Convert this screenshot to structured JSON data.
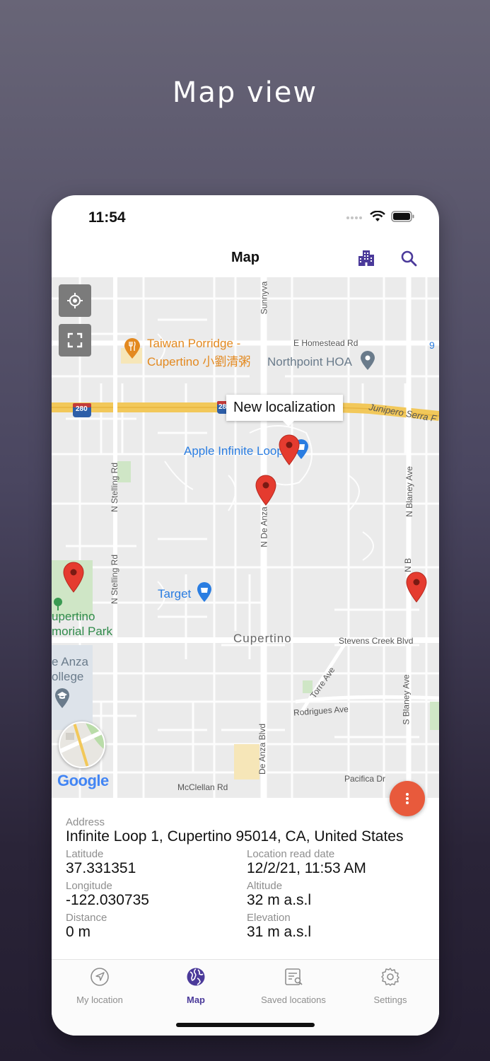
{
  "promo": {
    "title": "Map view"
  },
  "status_bar": {
    "time": "11:54"
  },
  "nav": {
    "title": "Map",
    "buildings_icon": "buildings-icon",
    "search_icon": "search-icon"
  },
  "map": {
    "controls": [
      "my-location-icon",
      "fullscreen-icon"
    ],
    "pois": {
      "taiwan_porridge_1": "Taiwan Porridge -",
      "taiwan_porridge_2": "Cupertino 小劉清粥",
      "northpoint": "Northpoint HOA",
      "apple": "Apple Infinite Loop",
      "target": "Target",
      "cupertino": "Cupertino",
      "memorial_1": "upertino",
      "memorial_2": "morial Park",
      "college_1": "e Anza",
      "college_2": "ollege"
    },
    "roads": {
      "homestead": "E Homestead Rd",
      "junipero": "Junipero Serra F",
      "sunnyvale": "Sunnyva",
      "stelling_1": "N Stelling Rd",
      "stelling_2": "N Stelling Rd",
      "deanza_n": "N De Anza",
      "deanza_blvd": "De Anza Blvd",
      "blaney_1": "N Blaney Ave",
      "blaney_2": "N B",
      "blaney_s": "S Blaney Ave",
      "stevens": "Stevens Creek Blvd",
      "torre": "Torre Ave",
      "rodrigues": "Rodrigues Ave",
      "pacifica": "Pacifica Dr",
      "mcclellan": "McClellan Rd",
      "i280": "280",
      "i280b": "28",
      "hwy9": "9"
    },
    "tooltip": "New localization",
    "google": "Google"
  },
  "colors": {
    "accent": "#4b3a9a",
    "pin": "#e53b2f",
    "fab": "#e85a3c",
    "poi_orange": "#e3891f",
    "poi_blue": "#2a7de1",
    "poi_gray": "#6a7b8b"
  },
  "info": {
    "address_label": "Address",
    "address": "Infinite Loop 1, Cupertino 95014, CA, United States",
    "latitude_label": "Latitude",
    "latitude": "37.331351",
    "read_date_label": "Location read date",
    "read_date": "12/2/21, 11:53 AM",
    "longitude_label": "Longitude",
    "longitude": "-122.030735",
    "altitude_label": "Altitude",
    "altitude": "32 m a.s.l",
    "distance_label": "Distance",
    "distance": "0 m",
    "elevation_label": "Elevation",
    "elevation": "31 m a.s.l"
  },
  "tabs": [
    {
      "label": "My location",
      "icon": "navigation-arrow-icon"
    },
    {
      "label": "Map",
      "icon": "globe-icon"
    },
    {
      "label": "Saved locations",
      "icon": "saved-list-icon"
    },
    {
      "label": "Settings",
      "icon": "gear-icon"
    }
  ]
}
